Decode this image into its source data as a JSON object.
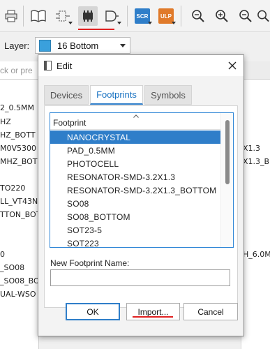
{
  "toolbar": {
    "icons": [
      "printer-icon",
      "book-icon",
      "schematic-symbol-icon",
      "package-icon",
      "device-icon",
      "scr-icon",
      "ulp-icon",
      "zoom-fit-icon",
      "zoom-in-icon",
      "zoom-out-icon",
      "zoom-icon"
    ],
    "scr_label": "SCR",
    "ulp_label": "ULP",
    "colors": {
      "active_underline": "#e02020",
      "scr": "#2f7ec9",
      "ulp": "#e07a2a"
    }
  },
  "layer": {
    "label": "Layer:",
    "value": "16 Bottom",
    "swatch_color": "#3aa0dc"
  },
  "background_left": {
    "search_placeholder": "ck or pre",
    "items": [
      "2_0.5MM",
      "HZ",
      "HZ_BOTT",
      "M0V5300",
      "MHZ_BOT",
      "TO220",
      "LL_VT43N",
      "TTON_BOT",
      "0",
      "_SO08",
      "_SO08_BO",
      "UAL-WSO"
    ]
  },
  "background_right": {
    "items": [
      "X1.3",
      "X1.3_B",
      "H_6.0M"
    ]
  },
  "dialog": {
    "title": "Edit",
    "tabs": [
      {
        "label": "Devices",
        "active": false
      },
      {
        "label": "Footprints",
        "active": true
      },
      {
        "label": "Symbols",
        "active": false
      }
    ],
    "list_header": "Footprint",
    "footprints": [
      "NANOCRYSTAL",
      "PAD_0.5MM",
      "PHOTOCELL",
      "RESONATOR-SMD-3.2X1.3",
      "RESONATOR-SMD-3.2X1.3_BOTTOM",
      "SO08",
      "SO08_BOTTOM",
      "SOT23-5",
      "SOT223"
    ],
    "selected": "NANOCRYSTAL",
    "new_name_label": "New Footprint Name:",
    "new_name_value": "",
    "buttons": {
      "ok": "OK",
      "import": "Import...",
      "cancel": "Cancel"
    },
    "colors": {
      "accent": "#2f7ec9",
      "import_underline": "#e02020"
    }
  }
}
